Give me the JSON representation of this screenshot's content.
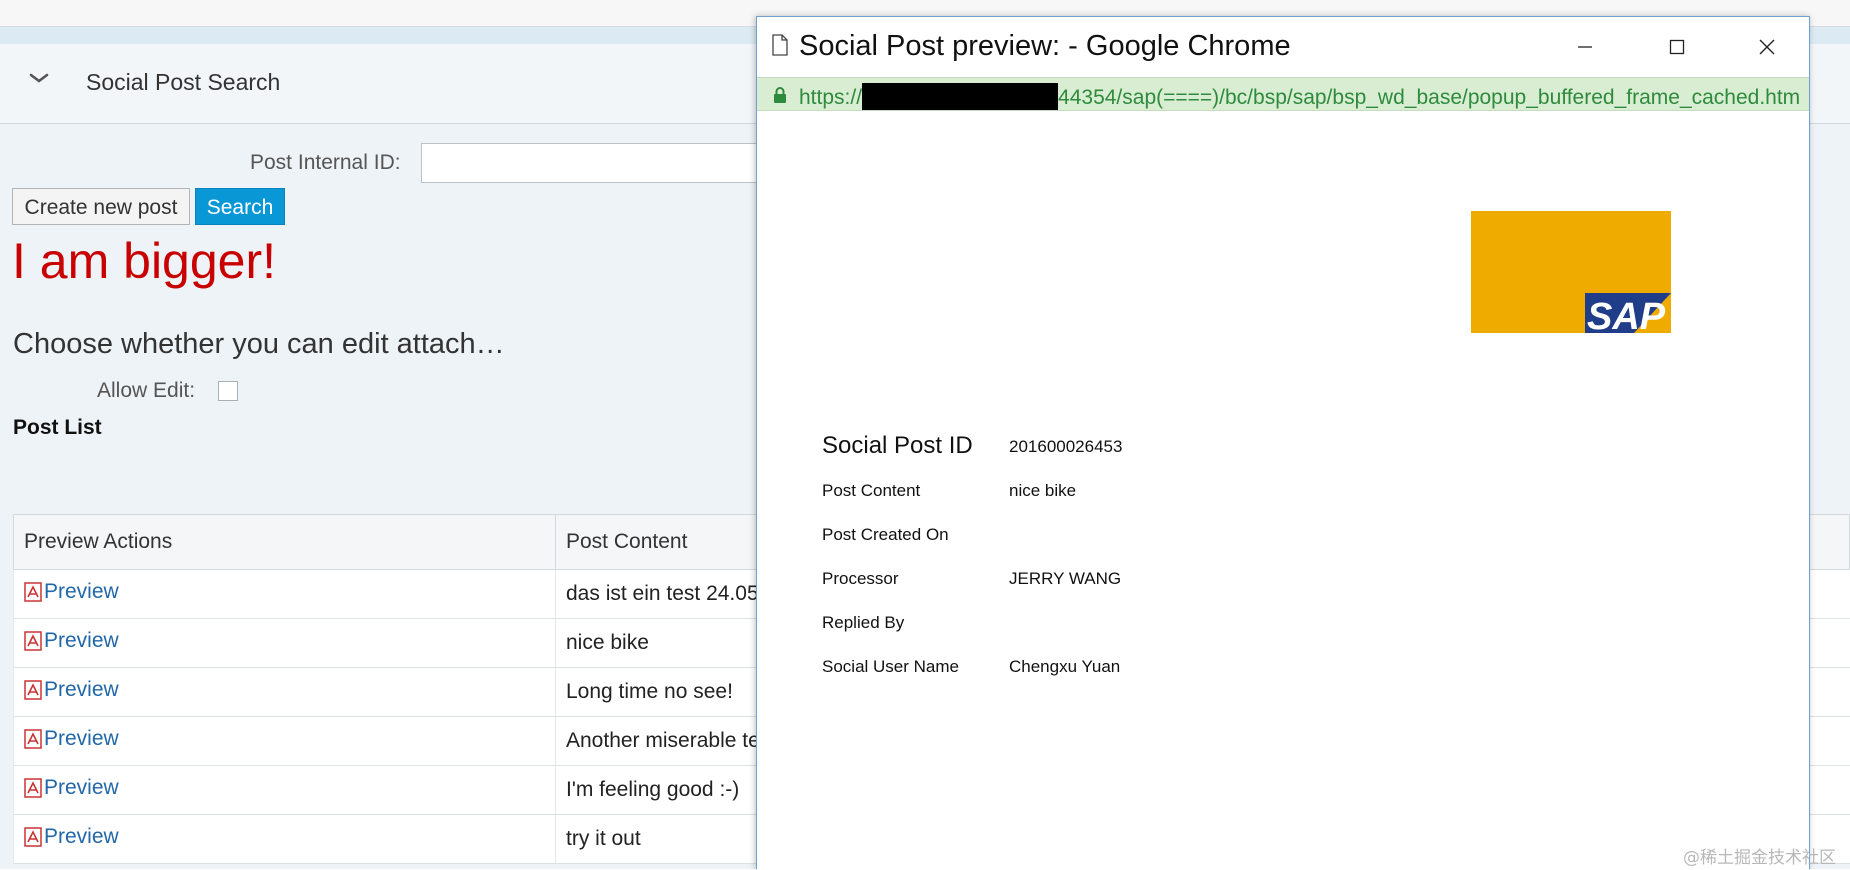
{
  "app": {
    "section_title": "Social Post Search",
    "post_id_label": "Post Internal ID:",
    "post_id_value": "",
    "create_button": "Create new post",
    "search_button": "Search",
    "big_text": "I am bigger!",
    "choose_text": "Choose whether you can edit attach…",
    "allow_edit_label": "Allow Edit:",
    "allow_edit_checked": false,
    "post_list_title": "Post List",
    "colors": {
      "search_button": "#0a97d6",
      "big_text": "#c80000",
      "link": "#2267a8"
    }
  },
  "table": {
    "headers": [
      "Preview Actions",
      "Post Content"
    ],
    "rows": [
      {
        "action": "Preview",
        "content": "das ist ein test 24.05"
      },
      {
        "action": "Preview",
        "content": "nice bike"
      },
      {
        "action": "Preview",
        "content": "Long time no see!"
      },
      {
        "action": "Preview",
        "content": "Another miserable te"
      },
      {
        "action": "Preview",
        "content": "I'm feeling good :-)"
      },
      {
        "action": "Preview",
        "content": "try it out"
      }
    ],
    "action_icon": "pdf-icon"
  },
  "popup": {
    "window_title": "Social Post preview: - Google Chrome",
    "url_prefix": "https://",
    "url_suffix": "44354/sap(====)/bc/bsp/sap/bsp_wd_base/popup_buffered_frame_cached.htm",
    "logo_text": "SAP",
    "colors": {
      "logo_gold": "#f0ab00",
      "logo_blue": "#1f3d88",
      "address_bar": "#d9edd2",
      "url_text": "#2e8b3d"
    },
    "fields": {
      "social_post_id": {
        "label": "Social Post ID",
        "value": "201600026453"
      },
      "post_content": {
        "label": "Post Content",
        "value": "nice bike"
      },
      "post_created_on": {
        "label": "Post Created On",
        "value": ""
      },
      "processor": {
        "label": "Processor",
        "value": "JERRY WANG"
      },
      "replied_by": {
        "label": "Replied By",
        "value": ""
      },
      "social_user_name": {
        "label": "Social User Name",
        "value": "Chengxu Yuan"
      }
    }
  },
  "watermark": "@稀土掘金技术社区"
}
